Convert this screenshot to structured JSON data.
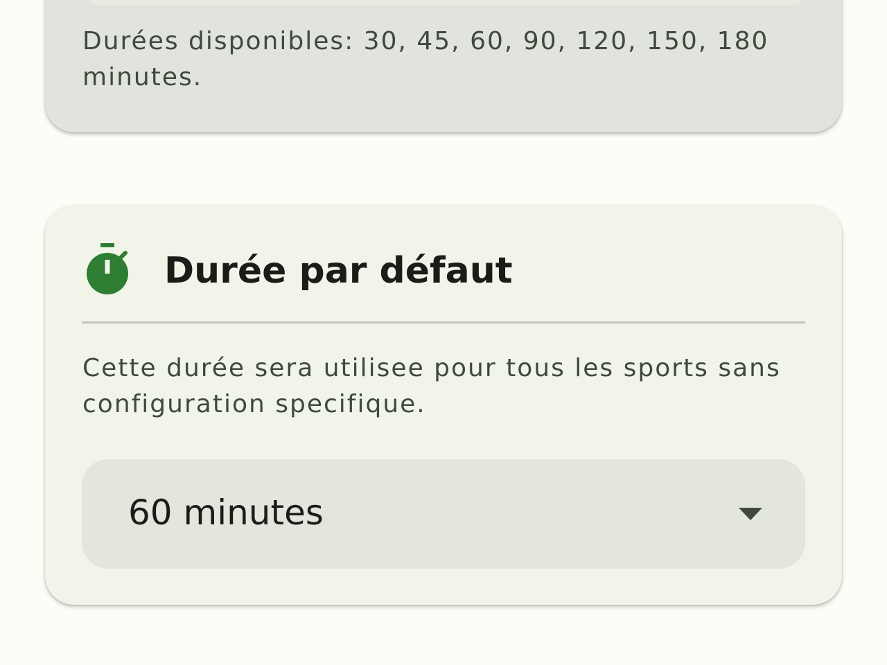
{
  "durations_card": {
    "available_text": "Durées disponibles: 30, 45, 60, 90, 120, 150, 180 minutes."
  },
  "default_duration_card": {
    "icon": "timer-icon",
    "title": "Durée par défaut",
    "description": "Cette durée sera utilisee pour tous les sports sans configuration specifique.",
    "select": {
      "selected_value": "60 minutes",
      "icon": "arrow-drop-down-icon"
    }
  },
  "colors": {
    "accent_green": "#2e7d32",
    "card_background": "#f1f5e9",
    "top_card_background": "#e1e4dc",
    "dropdown_background": "#e3e6dd"
  }
}
